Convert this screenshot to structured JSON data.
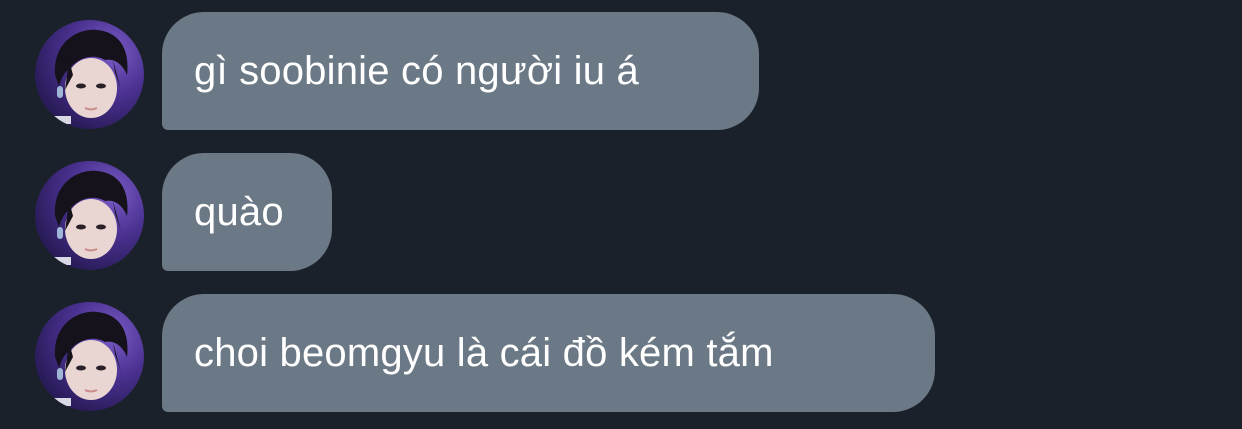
{
  "messages": [
    {
      "text": "gì soobinie có người iu á"
    },
    {
      "text": "quào"
    },
    {
      "text": "choi beomgyu là cái đồ kém tắm"
    }
  ],
  "colors": {
    "background": "#1b212a",
    "bubble": "#6b7885",
    "text": "#ffffff"
  }
}
